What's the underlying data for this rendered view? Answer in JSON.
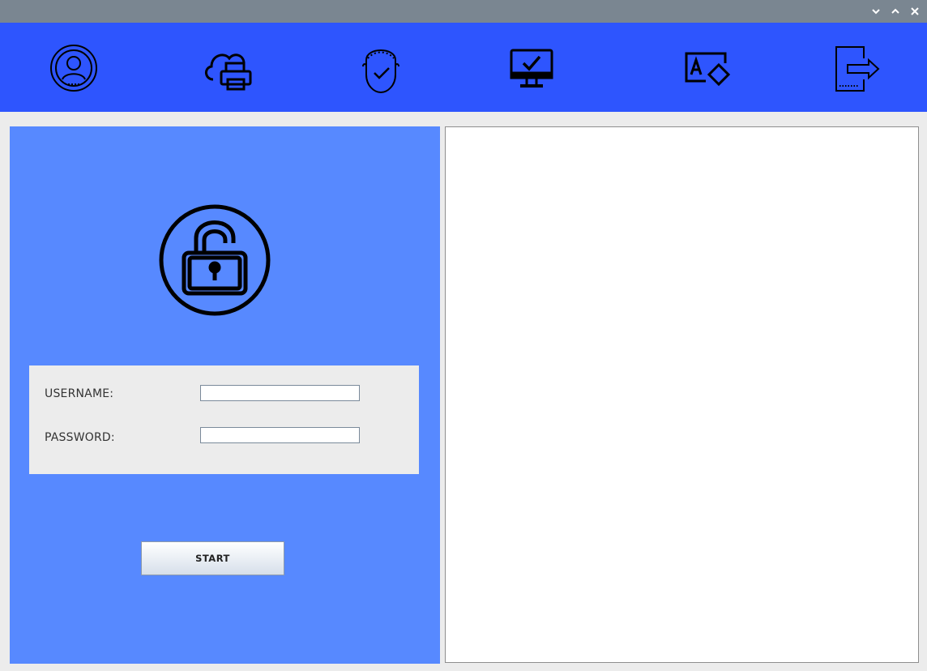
{
  "window": {
    "controls": [
      "minimize-icon",
      "maximize-icon",
      "close-icon"
    ]
  },
  "toolbar": {
    "items": [
      {
        "icon": "user-profile-icon"
      },
      {
        "icon": "cloud-printer-icon"
      },
      {
        "icon": "verified-face-icon"
      },
      {
        "icon": "monitor-check-icon"
      },
      {
        "icon": "text-edit-icon"
      },
      {
        "icon": "logout-icon"
      }
    ]
  },
  "login": {
    "lock_icon": "lock-icon",
    "username_label": "USERNAME:",
    "username_value": "",
    "password_label": "PASSWORD:",
    "password_value": "",
    "start_label": "START"
  },
  "colors": {
    "titlebar": "#7a8691",
    "toolbar": "#2e55fe",
    "left_panel": "#5789ff",
    "form_background": "#ececec",
    "output_background": "#ffffff"
  }
}
